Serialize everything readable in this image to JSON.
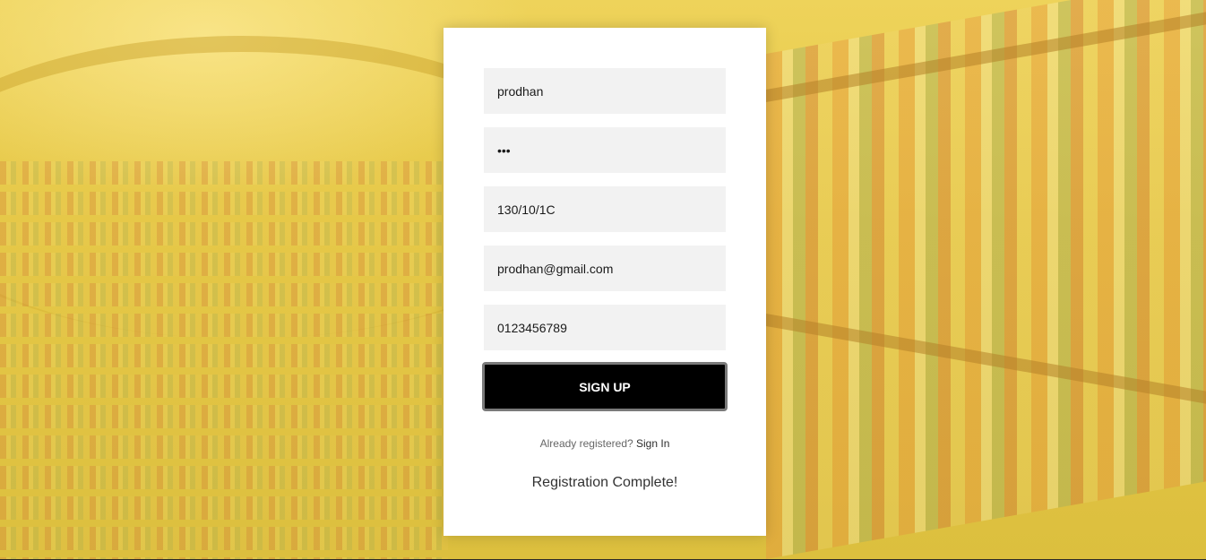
{
  "form": {
    "name_value": "prodhan",
    "password_value": "•••",
    "address_value": "130/10/1C",
    "email_value": "prodhan@gmail.com",
    "phone_value": "0123456789",
    "signup_label": "SIGN UP",
    "already_text": "Already registered?",
    "signin_link": "Sign In",
    "status_message": "Registration Complete!"
  },
  "colors": {
    "background_tint": "#e6c848",
    "field_bg": "#f2f2f2",
    "button_bg": "#000000",
    "button_text": "#ffffff"
  }
}
